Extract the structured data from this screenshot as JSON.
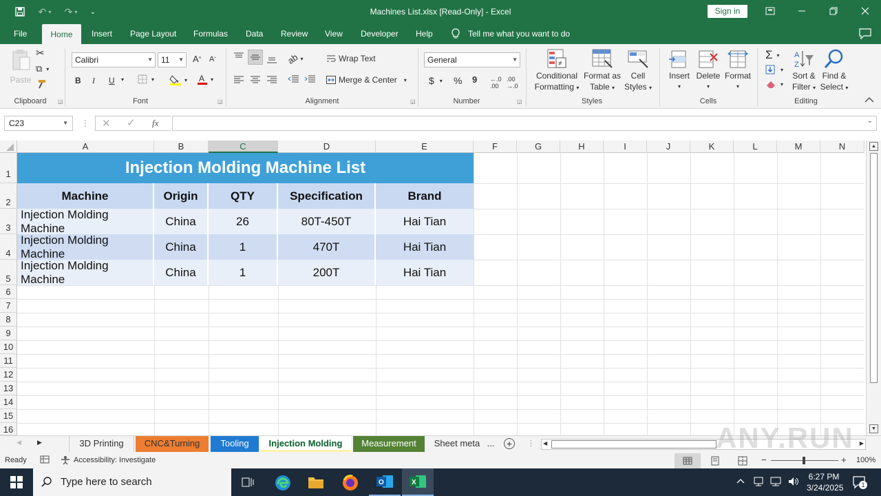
{
  "app": {
    "title": "Machines List.xlsx  [Read-Only]  -  Excel",
    "signin": "Sign in"
  },
  "menu": {
    "tabs": [
      "File",
      "Home",
      "Insert",
      "Page Layout",
      "Formulas",
      "Data",
      "Review",
      "View",
      "Developer",
      "Help"
    ],
    "active": "Home",
    "tell_me": "Tell me what you want to do"
  },
  "ribbon": {
    "clipboard": {
      "label": "Clipboard",
      "paste": "Paste"
    },
    "font": {
      "label": "Font",
      "name": "Calibri",
      "size": "11",
      "bold": "B",
      "italic": "I",
      "underline": "U"
    },
    "alignment": {
      "label": "Alignment",
      "wrap_text": "Wrap Text",
      "merge_center": "Merge & Center"
    },
    "number": {
      "label": "Number",
      "format": "General",
      "currency": "$",
      "percent": "%",
      "comma": "9"
    },
    "styles": {
      "label": "Styles",
      "conditional_1": "Conditional",
      "conditional_2": "Formatting",
      "format_table_1": "Format as",
      "format_table_2": "Table",
      "cell_styles_1": "Cell",
      "cell_styles_2": "Styles"
    },
    "cells": {
      "label": "Cells",
      "insert": "Insert",
      "delete": "Delete",
      "format": "Format"
    },
    "editing": {
      "label": "Editing",
      "sort_1": "Sort &",
      "sort_2": "Filter",
      "find_1": "Find &",
      "find_2": "Select"
    }
  },
  "formula_bar": {
    "name_box": "C23",
    "fx": "fx",
    "content": ""
  },
  "columns": [
    "A",
    "B",
    "C",
    "D",
    "E",
    "F",
    "G",
    "H",
    "I",
    "J",
    "K",
    "L",
    "M",
    "N"
  ],
  "rows": [
    "1",
    "2",
    "3",
    "4",
    "5",
    "6",
    "7",
    "8",
    "9",
    "10",
    "11",
    "12",
    "13",
    "14",
    "15",
    "16"
  ],
  "table": {
    "title": "Injection Molding Machine List",
    "headers": [
      "Machine",
      "Origin",
      "QTY",
      "Specification",
      "Brand"
    ],
    "rows": [
      [
        "Injection Molding Machine",
        "China",
        "26",
        "80T-450T",
        "Hai Tian"
      ],
      [
        "Injection Molding Machine",
        "China",
        "1",
        "470T",
        "Hai Tian"
      ],
      [
        "Injection Molding Machine",
        "China",
        "1",
        "200T",
        "Hai Tian"
      ]
    ],
    "colors": {
      "title_bg": "#3fa0d8",
      "header_bg": "#c9d9f1",
      "row_light": "#e9eff9",
      "row_dark": "#cfdcf2"
    }
  },
  "sheets": [
    {
      "name": "3D Printing",
      "color": ""
    },
    {
      "name": "CNC&Turning",
      "color": "#ed7d31"
    },
    {
      "name": "Tooling",
      "color": "#1f7ad1"
    },
    {
      "name": "Injection Molding",
      "color": "#fff2a8",
      "active": true
    },
    {
      "name": "Measurement",
      "color": "#548235"
    },
    {
      "name": "Sheet meta",
      "color": ""
    }
  ],
  "sheet_more": "...",
  "status": {
    "ready": "Ready",
    "accessibility": "Accessibility: Investigate",
    "zoom": "100%"
  },
  "taskbar": {
    "search_placeholder": "Type here to search",
    "time": "6:27 PM",
    "date": "3/24/2025",
    "notifications": "1"
  },
  "watermark": "ANY.RUN"
}
